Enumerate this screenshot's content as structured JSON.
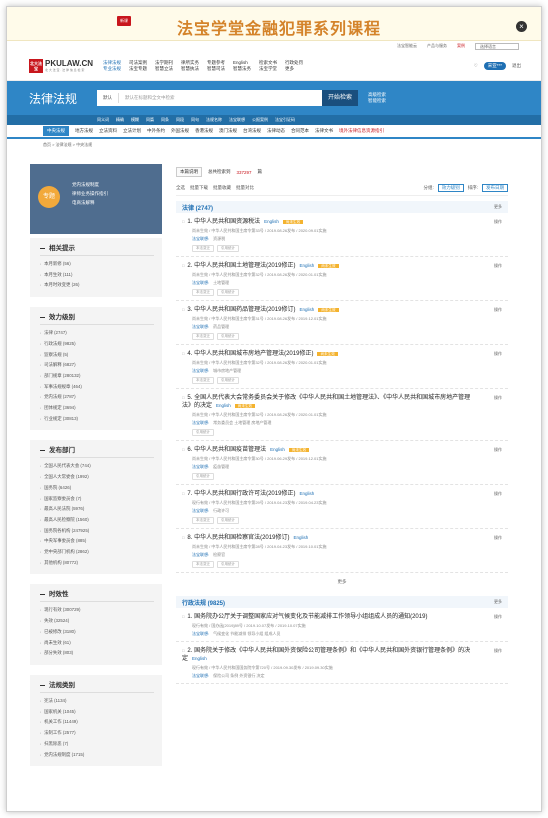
{
  "banner": {
    "badge": "新课",
    "title": "法宝学堂金融犯罪系列课程",
    "close": "×"
  },
  "toplinks": {
    "items": [
      "法宝智能云",
      "产品与服务",
      "案例",
      "选择语言"
    ],
    "lang": "选择语言"
  },
  "header": {
    "logo_mark": "北大法宝",
    "logo_text": "PKULAW.CN",
    "logo_sub": "北 大 法 宝 · 法 律 信 息 检 索",
    "nav": [
      {
        "l1": "法律法规",
        "l2": "专业法规",
        "active": true
      },
      {
        "l1": "司法案例",
        "l2": "法宝专题"
      },
      {
        "l1": "法学期刊",
        "l2": "智慧立法"
      },
      {
        "l1": "律所实务",
        "l2": "智慧执法"
      },
      {
        "l1": "专题参考",
        "l2": "智慧司法"
      },
      {
        "l1": "English",
        "l2": "智慧法务"
      },
      {
        "l1": "检索文书",
        "l2": "法宝学堂"
      },
      {
        "l1": "行政处罚",
        "l2": "更多"
      }
    ],
    "user": "宋亚***",
    "logout": "退出"
  },
  "search": {
    "section_title": "法律法规",
    "scope": "默认",
    "placeholder": "默认在标题和全文中检索",
    "button": "开始检索",
    "adv1": "高级检索",
    "adv2": "智能检索",
    "options": [
      "同义词",
      "精确",
      "模糊",
      "同篇",
      "同条",
      "同段",
      "同句"
    ],
    "links": [
      "法规名称",
      "法宝联想",
      "公报案例",
      "法宝引证码"
    ]
  },
  "catbar": {
    "items": [
      "中央法规",
      "地方法规",
      "立法资料",
      "立法计划",
      "中外条约",
      "外国法规",
      "香港法规",
      "澳门法规",
      "台湾法规",
      "法律动态",
      "合同范本",
      "法律文书"
    ],
    "hot": "境外法律信息资源指引"
  },
  "breadcrumb": "首页 > 法律法规 > 中央法规",
  "promo": {
    "badge": "专题",
    "lines": [
      "党内法规制度",
      "律师业务操作指引",
      "电商法解释"
    ]
  },
  "sidebar": [
    {
      "title": "相关提示",
      "items": [
        "本月新修 (56)",
        "本月生效 (111)",
        "本月时效变更 (26)"
      ]
    },
    {
      "title": "效力级别",
      "items": [
        "法律 (2747)",
        "行政法规 (9825)",
        "监察法规 (5)",
        "司法解释 (6827)",
        "部门规章 (280132)",
        "军事法规规章 (464)",
        "党内法规 (2787)",
        "团体规定 (3694)",
        "行业规定 (30813)"
      ]
    },
    {
      "title": "发布部门",
      "items": [
        "全国人民代表大会 (744)",
        "全国人大常委会 (1992)",
        "国务院 (6426)",
        "国家监察委员会 (7)",
        "最高人民法院 (5976)",
        "最高人民检察院 (1560)",
        "国务院各机构 (247925)",
        "中央军事委员会 (885)",
        "党中央部门机构 (2862)",
        "其他机构 (80772)"
      ]
    },
    {
      "title": "时效性",
      "items": [
        "现行有效 (300729)",
        "失效 (32524)",
        "已被修改 (3180)",
        "尚未生效 (61)",
        "部分失效 (803)"
      ]
    },
    {
      "title": "法规类别",
      "items": [
        "宪法 (1134)",
        "国家机关 (1045)",
        "机关工作 (11449)",
        "法制工作 (2577)",
        "扫黑除恶 (7)",
        "党内法规制度 (1715)"
      ]
    }
  ],
  "results": {
    "sort_btn": "本篇说明",
    "total_prefix": "总共检索到",
    "total": "337297",
    "total_suffix": "篇",
    "toolbar": [
      "全选",
      "批量下载",
      "批量收藏",
      "批量对比"
    ],
    "group_label": "分组:",
    "group_val": "效力级别",
    "sort_label": "排序:",
    "sort_val": "发布日期"
  },
  "groups": [
    {
      "name": "法律 (2747)",
      "more": "更多",
      "rows": [
        {
          "title": "1. 中华人民共和国资源税法",
          "en": "English",
          "status": "尚未生效",
          "meta": "尚未生效 / 中华人民共和国主席令第33号 / 2019.08.26发布 / 2020.09.01实施",
          "kw": "资源税",
          "tags": [
            "本法变迁",
            "引用统计"
          ]
        },
        {
          "title": "2. 中华人民共和国土地管理法(2019修正)",
          "en": "English",
          "status": "尚未生效",
          "meta": "尚未生效 / 中华人民共和国主席令第32号 / 2019.08.26发布 / 2020.01.01实施",
          "kw": "土地管理",
          "tags": [
            "本法变迁",
            "引用统计"
          ]
        },
        {
          "title": "3. 中华人民共和国药品管理法(2019修订)",
          "en": "English",
          "status": "尚未生效",
          "meta": "尚未生效 / 中华人民共和国主席令第31号 / 2019.08.26发布 / 2019.12.01实施",
          "kw": "药品管理",
          "tags": [
            "本法变迁",
            "引用统计"
          ]
        },
        {
          "title": "4. 中华人民共和国城市房地产管理法(2019修正)",
          "en": "",
          "status": "尚未生效",
          "meta": "尚未生效 / 中华人民共和国主席令第32号 / 2019.08.26发布 / 2020.01.01实施",
          "kw": "城市房地产管理",
          "tags": [
            "本法变迁",
            "引用统计"
          ]
        },
        {
          "title": "5. 全国人民代表大会常务委员会关于修改《中华人民共和国土地管理法》、《中华人民共和国城市房地产管理法》的决定",
          "en": "English",
          "status": "尚未生效",
          "meta": "尚未生效 / 中华人民共和国主席令第32号 / 2019.08.26发布 / 2020.01.01实施",
          "kw": "常务委员会 土地管理 房地产管理",
          "tags": [
            "引用统计"
          ]
        },
        {
          "title": "6. 中华人民共和国疫苗管理法",
          "en": "English",
          "status": "尚未生效",
          "meta": "尚未生效 / 中华人民共和国主席令第30号 / 2019.06.29发布 / 2019.12.01实施",
          "kw": "疫苗管理",
          "tags": [
            "引用统计"
          ]
        },
        {
          "title": "7. 中华人民共和国行政许可法(2019修正)",
          "en": "English",
          "status": "",
          "meta": "现行有效 / 中华人民共和国主席令第29号 / 2019.04.23发布 / 2019.04.23实施",
          "kw": "行政许可",
          "tags": [
            "本法变迁",
            "引用统计"
          ]
        },
        {
          "title": "8. 中华人民共和国检察官法(2019修订)",
          "en": "English",
          "status": "",
          "meta": "尚未生效 / 中华人民共和国主席令第28号 / 2019.04.23发布 / 2019.10.01实施",
          "kw": "检察官",
          "tags": [
            "本法变迁",
            "引用统计"
          ]
        }
      ],
      "more_line": "更多"
    },
    {
      "name": "行政法规 (9825)",
      "more": "更多",
      "rows": [
        {
          "title": "1. 国务院办公厅关于调整国家应对气候变化及节能减排工作领导小组组成人员的通知(2019)",
          "en": "",
          "status": "",
          "meta": "现行有效 / 国办函[2019]89号 / 2019.10.07发布 / 2019.10.07实施",
          "kw": "气候变化 节能减排 领导小组 组成人员",
          "tags": []
        },
        {
          "title": "2. 国务院关于修改《中华人民共和国外资保险公司管理条例》和《中华人民共和国外资银行管理条例》的决定",
          "en": "English",
          "status": "",
          "meta": "现行有效 / 中华人民共和国国务院令第720号 / 2019.09.30发布 / 2019.09.30实施",
          "kw": "保险公司 条例 外资银行 决定",
          "tags": []
        }
      ]
    }
  ],
  "ops_label": "操作"
}
